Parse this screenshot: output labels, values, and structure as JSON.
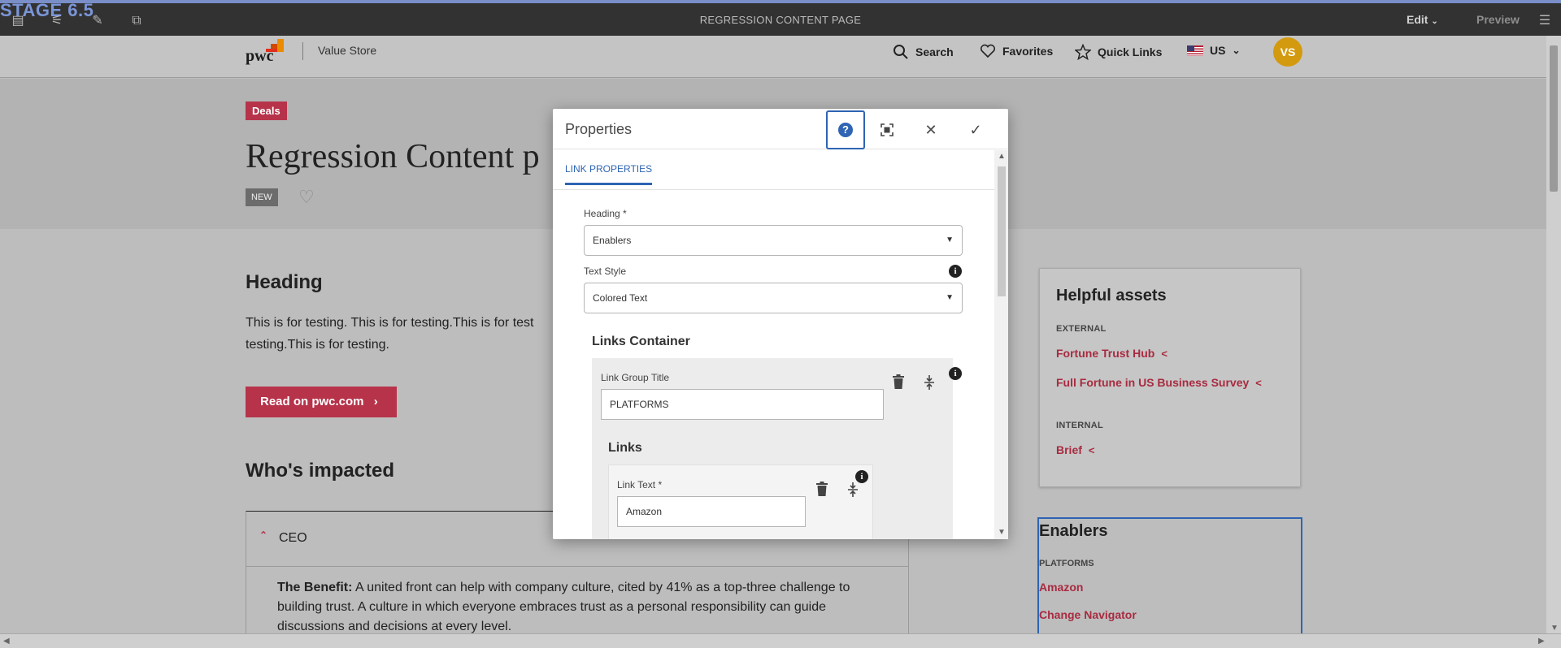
{
  "editor": {
    "stage_label": "STAGE 6.5",
    "page_title": "REGRESSION CONTENT PAGE",
    "mode": "Edit",
    "preview": "Preview"
  },
  "header": {
    "logo_text": "pwc",
    "store_name": "Value Store",
    "search": "Search",
    "favorites": "Favorites",
    "quick_links": "Quick Links",
    "region": "US",
    "avatar_initials": "VS"
  },
  "hero": {
    "badge": "Deals",
    "title": "Regression Content p",
    "new_badge": "NEW"
  },
  "main": {
    "heading": "Heading",
    "body": "This is for testing. This is for testing.This is for test testing.This is for testing.",
    "read_button": "Read on pwc.com",
    "impacted_heading": "Who's impacted",
    "impact_label": "CEO",
    "benefit_title": "The Benefit:",
    "benefit_text": " A united front can help with company culture, cited by 41% as a top-three challenge to building trust. A culture in which everyone embraces trust as a personal responsibility can guide discussions and decisions at every level."
  },
  "helpful_assets": {
    "title": "Helpful assets",
    "external_label": "EXTERNAL",
    "external_links": [
      "Fortune Trust Hub",
      "Full Fortune in US Business Survey"
    ],
    "internal_label": "INTERNAL",
    "internal_links": [
      "Brief"
    ]
  },
  "enablers": {
    "title": "Enablers",
    "category": "PLATFORMS",
    "links": [
      "Amazon",
      "Change Navigator"
    ]
  },
  "dialog": {
    "title": "Properties",
    "tab": "LINK PROPERTIES",
    "heading_label": "Heading *",
    "heading_value": "Enablers",
    "text_style_label": "Text Style",
    "text_style_value": "Colored Text",
    "links_container": "Links Container",
    "link_group_title_label": "Link Group Title",
    "link_group_title_value": "PLATFORMS",
    "links_label": "Links",
    "link_text_label": "Link Text *",
    "link_text_value": "Amazon"
  },
  "colors": {
    "brand_red": "#b6334a",
    "link_red": "#a82b40",
    "accent_blue": "#2e64b3",
    "avatar_gold": "#d39a0f"
  }
}
